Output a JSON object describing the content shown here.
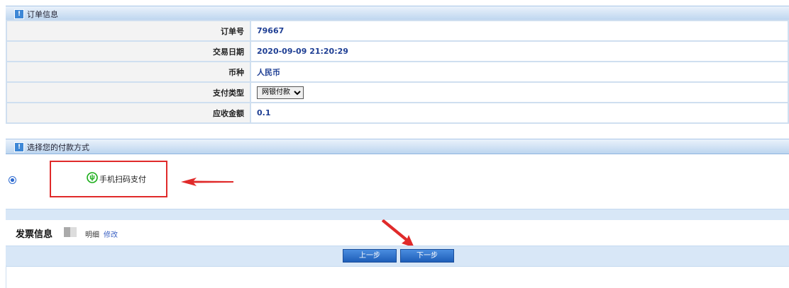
{
  "order_section": {
    "badge": "!",
    "title": "订单信息",
    "rows": [
      {
        "label": "订单号",
        "value": "79667"
      },
      {
        "label": "交易日期",
        "value": "2020-09-09 21:20:29"
      },
      {
        "label": "币种",
        "value": "人民币"
      },
      {
        "label": "支付类型",
        "value": "网银付款"
      },
      {
        "label": "应收金额",
        "value": "0.1"
      }
    ]
  },
  "payment_section": {
    "badge": "!",
    "title": "选择您的付款方式",
    "option_label": "手机扫码支付",
    "selected": true
  },
  "invoice": {
    "label": "发票信息",
    "detail": "明细",
    "edit": "修改"
  },
  "buttons": {
    "prev": "上一步",
    "next": "下一步"
  },
  "colors": {
    "annotation_red": "#e02a2a",
    "button_blue": "#1e5eb8",
    "value_text": "#1f3f94",
    "wechat_green": "#1aad19"
  }
}
